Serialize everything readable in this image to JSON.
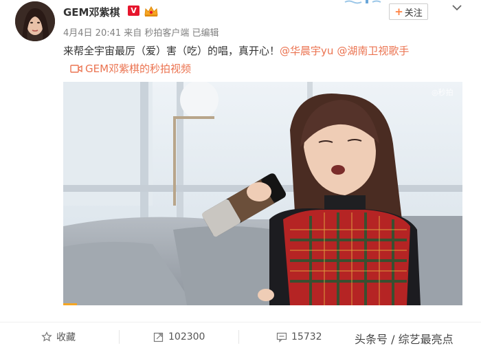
{
  "user": {
    "name": "GEM邓紫棋",
    "verified_badge": "V"
  },
  "post": {
    "meta": "4月4日 20:41 来自 秒拍客户端   已编辑",
    "text_main": "来帮全宇宙最厉（爱）害（吃）的唱，真开心！",
    "mention_1": "@华晨宇yu",
    "mention_2": "@湖南卫视歌手",
    "video_link": "GEM邓紫棋的秒拍视频",
    "video_watermark": "◎秒拍"
  },
  "follow": {
    "plus": "+",
    "label": "关注"
  },
  "actions": {
    "favorite": "收藏",
    "repost_count": "102300",
    "comment_count": "15732"
  },
  "watermark": "头条号 / 综艺最亮点",
  "colors": {
    "accent_link": "#eb7350",
    "follow_plus": "#ff8140",
    "verified": "#e6162d",
    "progress": "#f5a623"
  }
}
